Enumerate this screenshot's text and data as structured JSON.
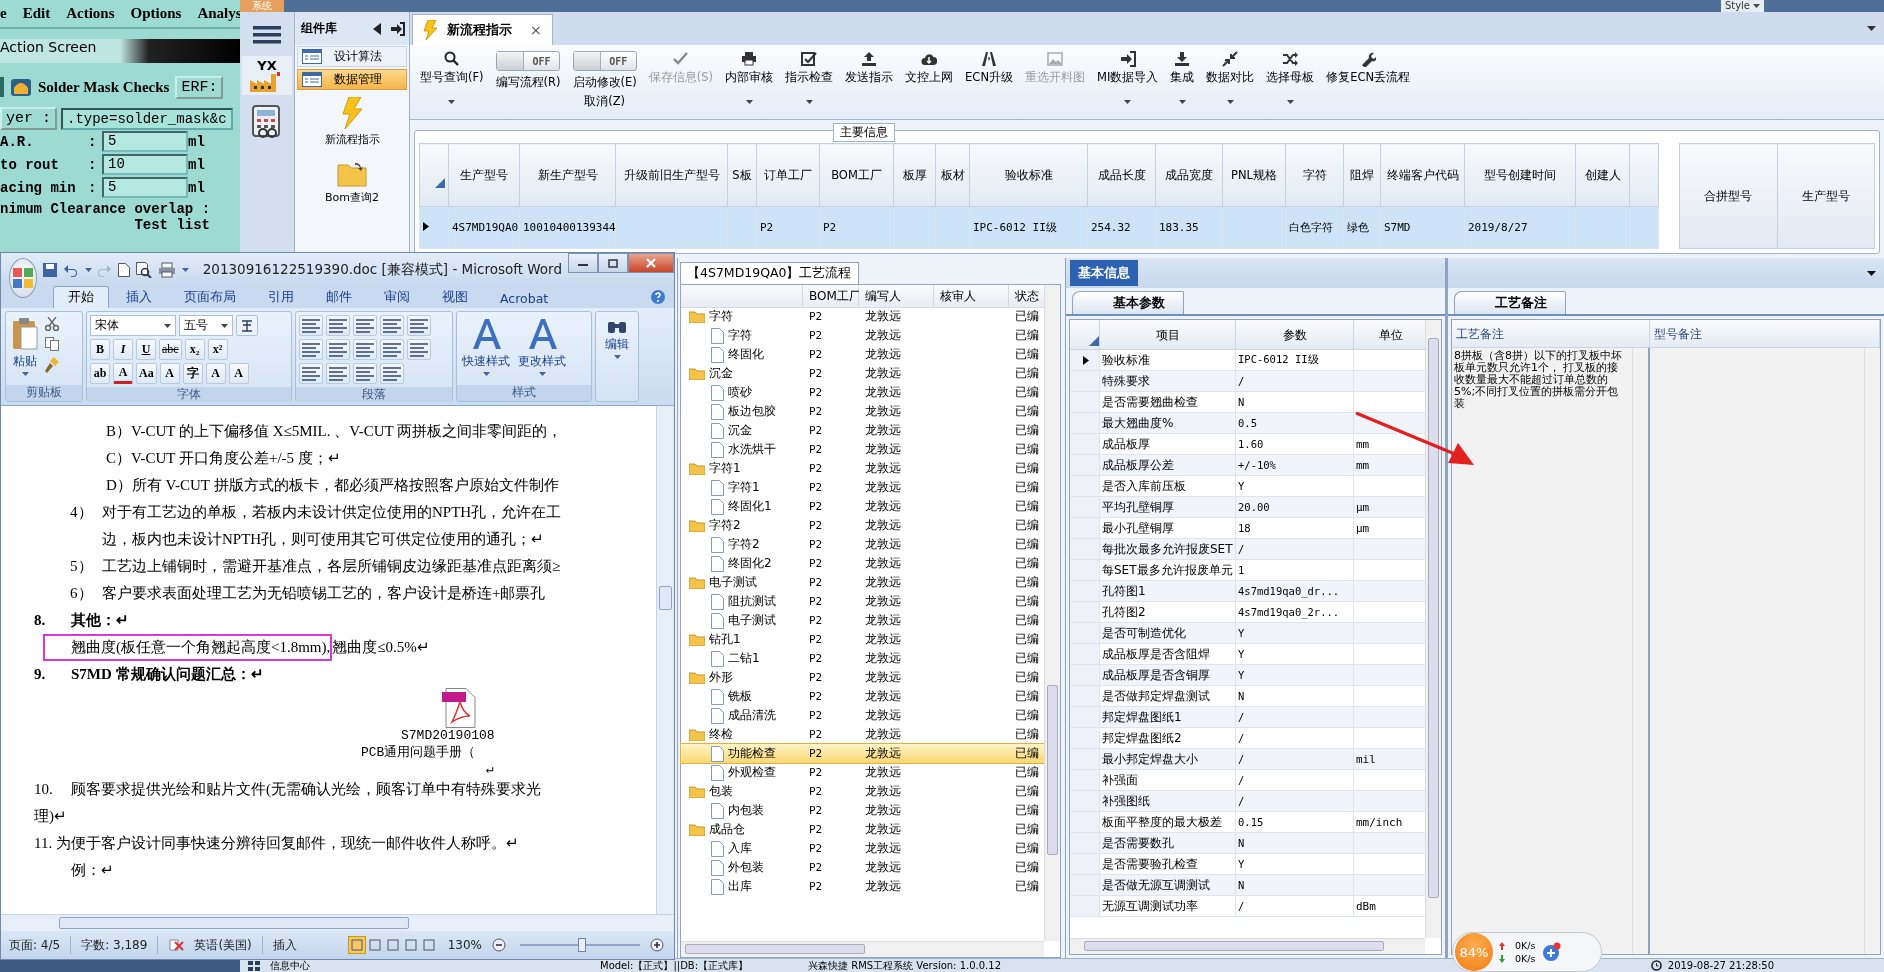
{
  "legacy_app": {
    "menu": [
      "e",
      "Edit",
      "Actions",
      "Options",
      "Analys"
    ],
    "title": "Action Screen",
    "panel_title": "Solder Mask Checks",
    "erf_label": "ERF:",
    "layer_label": "yer :",
    "layer_value": ".type=solder_mask&c",
    "fields": [
      {
        "label": "A.R.",
        "colon": ":",
        "value": "5",
        "unit": "ml"
      },
      {
        "label": "to rout",
        "colon": ":",
        "value": "10",
        "unit": "ml"
      },
      {
        "label": "acing min",
        "colon": ":",
        "value": "5",
        "unit": "ml"
      }
    ],
    "overlap_label": "nimum Clearance overlap :",
    "test_list_label": "Test list"
  },
  "app": {
    "system_tab": "系统",
    "style_menu": "Style",
    "logo_text": "YX",
    "library": {
      "title": "组件库",
      "groups": [
        {
          "label": "设计算法",
          "selected": false
        },
        {
          "label": "数据管理",
          "selected": true
        }
      ],
      "items": [
        {
          "label": "新流程指示",
          "kind": "bolt"
        },
        {
          "label": "Bom查询2",
          "kind": "folder"
        }
      ]
    },
    "tabs": [
      {
        "label": "新流程指示",
        "selected": true,
        "close": "×"
      }
    ],
    "toolbar": [
      {
        "kind": "button",
        "label": "型号查询(F)",
        "dropdown": true,
        "disabled": false
      },
      {
        "kind": "toggle",
        "label": "编写流程(R)",
        "switch_text": "OFF",
        "on": false
      },
      {
        "kind": "toggle",
        "label": "启动修改(E)",
        "sublabel": "取消(Z)",
        "switch_text": "OFF",
        "on": false
      },
      {
        "kind": "button",
        "label": "保存信息(S)",
        "dropdown": false,
        "disabled": true
      },
      {
        "kind": "button",
        "label": "内部审核",
        "dropdown": true,
        "disabled": false
      },
      {
        "kind": "button",
        "label": "指示检查",
        "dropdown": true,
        "disabled": false
      },
      {
        "kind": "button",
        "label": "发送指示",
        "dropdown": false,
        "disabled": false
      },
      {
        "kind": "button",
        "label": "文控上网",
        "dropdown": false,
        "disabled": false
      },
      {
        "kind": "button",
        "label": "ECN升级",
        "dropdown": false,
        "disabled": false
      },
      {
        "kind": "button",
        "label": "重选开料图",
        "dropdown": false,
        "disabled": true
      },
      {
        "kind": "button",
        "label": "MI数据导入",
        "dropdown": true,
        "disabled": false
      },
      {
        "kind": "button",
        "label": "集成",
        "dropdown": true,
        "disabled": false
      },
      {
        "kind": "button",
        "label": "数据对比",
        "dropdown": true,
        "disabled": false
      },
      {
        "kind": "button",
        "label": "选择母板",
        "dropdown": true,
        "disabled": false
      },
      {
        "kind": "button",
        "label": "修复ECN丢流程",
        "dropdown": false,
        "disabled": false
      }
    ],
    "main_info": {
      "title": "主要信息",
      "columns": [
        "生产型号",
        "新生产型号",
        "升级前旧生产型号",
        "S板",
        "订单工厂",
        "BOM工厂",
        "板厚",
        "板材",
        "验收标准",
        "成品长度",
        "成品宽度",
        "PNL规格",
        "字符",
        "阻焊",
        "终端客户代码",
        "型号创建时间",
        "创建人"
      ],
      "rows": [
        {
          "selected": true,
          "cells": {
            "col_1": "4S7MD19QA0",
            "col_2": "10010400139344",
            "col_5": "P2",
            "col_6": "P2",
            "col_9": "IPC-6012 II级",
            "col_10": "254.32",
            "col_11": "183.35",
            "col_13": "白色字符",
            "col_14": "绿色",
            "col_15": "S7MD",
            "col_16": "2019/8/27"
          }
        }
      ],
      "side_columns": [
        "合拼型号",
        "生产型号"
      ]
    }
  },
  "process_flow": {
    "title": "【4S7MD19QA0】工艺流程",
    "columns": [
      "BOM工厂",
      "编写人",
      "核审人",
      "状态"
    ],
    "tree": [
      {
        "label": "字符",
        "bom_factory": "P2",
        "author": "龙敦远",
        "status": "已编",
        "selected": false,
        "children": [
          {
            "label": "字符",
            "bom_factory": "P2",
            "author": "龙敦远",
            "status": "已编",
            "selected": false
          },
          {
            "label": "终固化",
            "bom_factory": "P2",
            "author": "龙敦远",
            "status": "已编",
            "selected": false
          }
        ]
      },
      {
        "label": "沉金",
        "bom_factory": "P2",
        "author": "龙敦远",
        "status": "已编",
        "selected": false,
        "children": [
          {
            "label": "喷砂",
            "bom_factory": "P2",
            "author": "龙敦远",
            "status": "已编",
            "selected": false
          },
          {
            "label": "板边包胶",
            "bom_factory": "P2",
            "author": "龙敦远",
            "status": "已编",
            "selected": false
          },
          {
            "label": "沉金",
            "bom_factory": "P2",
            "author": "龙敦远",
            "status": "已编",
            "selected": false
          },
          {
            "label": "水洗烘干",
            "bom_factory": "P2",
            "author": "龙敦远",
            "status": "已编",
            "selected": false
          }
        ]
      },
      {
        "label": "字符1",
        "bom_factory": "P2",
        "author": "龙敦远",
        "status": "已编",
        "selected": false,
        "children": [
          {
            "label": "字符1",
            "bom_factory": "P2",
            "author": "龙敦远",
            "status": "已编",
            "selected": false
          },
          {
            "label": "终固化1",
            "bom_factory": "P2",
            "author": "龙敦远",
            "status": "已编",
            "selected": false
          }
        ]
      },
      {
        "label": "字符2",
        "bom_factory": "P2",
        "author": "龙敦远",
        "status": "已编",
        "selected": false,
        "children": [
          {
            "label": "字符2",
            "bom_factory": "P2",
            "author": "龙敦远",
            "status": "已编",
            "selected": false
          },
          {
            "label": "终固化2",
            "bom_factory": "P2",
            "author": "龙敦远",
            "status": "已编",
            "selected": false
          }
        ]
      },
      {
        "label": "电子测试",
        "bom_factory": "P2",
        "author": "龙敦远",
        "status": "已编",
        "selected": false,
        "children": [
          {
            "label": "阻抗测试",
            "bom_factory": "P2",
            "author": "龙敦远",
            "status": "已编",
            "selected": false
          },
          {
            "label": "电子测试",
            "bom_factory": "P2",
            "author": "龙敦远",
            "status": "已编",
            "selected": false
          }
        ]
      },
      {
        "label": "钻孔1",
        "bom_factory": "P2",
        "author": "龙敦远",
        "status": "已编",
        "selected": false,
        "children": [
          {
            "label": "二钻1",
            "bom_factory": "P2",
            "author": "龙敦远",
            "status": "已编",
            "selected": false
          }
        ]
      },
      {
        "label": "外形",
        "bom_factory": "P2",
        "author": "龙敦远",
        "status": "已编",
        "selected": false,
        "children": [
          {
            "label": "铣板",
            "bom_factory": "P2",
            "author": "龙敦远",
            "status": "已编",
            "selected": false
          },
          {
            "label": "成品清洗",
            "bom_factory": "P2",
            "author": "龙敦远",
            "status": "已编",
            "selected": false
          }
        ]
      },
      {
        "label": "终检",
        "bom_factory": "P2",
        "author": "龙敦远",
        "status": "已编",
        "selected": false,
        "children": [
          {
            "label": "功能检查",
            "bom_factory": "P2",
            "author": "龙敦远",
            "status": "已编",
            "selected": true
          },
          {
            "label": "外观检查",
            "bom_factory": "P2",
            "author": "龙敦远",
            "status": "已编",
            "selected": false
          }
        ]
      },
      {
        "label": "包装",
        "bom_factory": "P2",
        "author": "龙敦远",
        "status": "已编",
        "selected": false,
        "children": [
          {
            "label": "内包装",
            "bom_factory": "P2",
            "author": "龙敦远",
            "status": "已编",
            "selected": false
          }
        ]
      },
      {
        "label": "成品仓",
        "bom_factory": "P2",
        "author": "龙敦远",
        "status": "已编",
        "selected": false,
        "children": [
          {
            "label": "入库",
            "bom_factory": "P2",
            "author": "龙敦远",
            "status": "已编",
            "selected": false
          },
          {
            "label": "外包装",
            "bom_factory": "P2",
            "author": "龙敦远",
            "status": "已编",
            "selected": false
          },
          {
            "label": "出库",
            "bom_factory": "P2",
            "author": "龙敦远",
            "status": "已编",
            "selected": false
          }
        ]
      }
    ]
  },
  "basic_info": {
    "panel_tab": "基本信息",
    "tab": "基本参数",
    "columns": [
      "项目",
      "参数",
      "单位"
    ],
    "rows": [
      {
        "item": "验收标准",
        "value": "IPC-6012 II级",
        "current": true
      },
      {
        "item": "特殊要求",
        "value": "/",
        "current": false
      },
      {
        "item": "是否需要翘曲检查",
        "value": "N",
        "current": false
      },
      {
        "item": "最大翘曲度%",
        "value": "0.5",
        "current": false
      },
      {
        "item": "成品板厚",
        "value": "1.60",
        "unit": "mm",
        "current": false
      },
      {
        "item": "成品板厚公差",
        "value": "+/-10%",
        "unit": "mm",
        "current": false
      },
      {
        "item": "是否入库前压板",
        "value": "Y",
        "current": false
      },
      {
        "item": "平均孔壁铜厚",
        "value": "20.00",
        "unit": "μm",
        "current": false
      },
      {
        "item": "最小孔壁铜厚",
        "value": "18",
        "unit": "μm",
        "current": false
      },
      {
        "item": "每批次最多允许报废SET",
        "value": "/",
        "current": false
      },
      {
        "item": "每SET最多允许报废单元",
        "value": "1",
        "current": false
      },
      {
        "item": "孔符图1",
        "value": "4s7md19qa0_dr...",
        "current": false
      },
      {
        "item": "孔符图2",
        "value": "4s7md19qa0_2r...",
        "current": false
      },
      {
        "item": "是否可制造优化",
        "value": "Y",
        "current": false
      },
      {
        "item": "成品板厚是否含阻焊",
        "value": "Y",
        "current": false
      },
      {
        "item": "成品板厚是否含铜厚",
        "value": "Y",
        "current": false
      },
      {
        "item": "是否做邦定焊盘测试",
        "value": "N",
        "current": false
      },
      {
        "item": "邦定焊盘图纸1",
        "value": "/",
        "current": false
      },
      {
        "item": "邦定焊盘图纸2",
        "value": "/",
        "current": false
      },
      {
        "item": "最小邦定焊盘大小",
        "value": "/",
        "unit": "mil",
        "current": false
      },
      {
        "item": "补强面",
        "value": "/",
        "current": false
      },
      {
        "item": "补强图纸",
        "value": "/",
        "current": false
      },
      {
        "item": "板面平整度的最大极差",
        "value": "0.15",
        "unit": "mm/inch",
        "current": false
      },
      {
        "item": "是否需要数孔",
        "value": "N",
        "current": false
      },
      {
        "item": "是否需要验孔检查",
        "value": "Y",
        "current": false
      },
      {
        "item": "是否做无源互调测试",
        "value": "N",
        "current": false
      },
      {
        "item": "无源互调测试功率",
        "value": "/",
        "unit": "dBm",
        "current": false
      }
    ]
  },
  "remarks": {
    "tab": "工艺备注",
    "columns": [
      "工艺备注",
      "型号备注"
    ],
    "process_note": "8拼板（含8拼）以下的打叉板中坏板单元数只允许1个， 打叉板的接收数量最大不能超过订单总数的5%;不同打叉位置的拼板需分开包装"
  },
  "status_bar": {
    "info_center": "信息中心",
    "model": "Model:【正式】||DB:【正式库】",
    "version": "兴森快捷 RMS工程系统 Version: 1.0.0.12",
    "time": "2019-08-27 21:28:50"
  },
  "net_widget": {
    "percent": "84%",
    "up": "0K/s",
    "down": "0K/s"
  },
  "word": {
    "title": "20130916122519390.doc [兼容模式] - Microsoft Word",
    "tabs": [
      {
        "label": "开始",
        "selected": true
      },
      {
        "label": "插入",
        "selected": false
      },
      {
        "label": "页面布局",
        "selected": false
      },
      {
        "label": "引用",
        "selected": false
      },
      {
        "label": "邮件",
        "selected": false
      },
      {
        "label": "审阅",
        "selected": false
      },
      {
        "label": "视图",
        "selected": false
      },
      {
        "label": "Acrobat",
        "selected": false
      }
    ],
    "paste": "粘贴",
    "font_name": "宋体",
    "font_size": "五号",
    "font_buttons": [
      "B",
      "I",
      "U",
      "abc",
      "x₂",
      "x²"
    ],
    "font_buttons_2": [
      "ab",
      "A",
      "Aa",
      "A",
      "字",
      "A",
      "A"
    ],
    "quick_style": "快速样式",
    "change_style": "更改样式",
    "edit": "编辑",
    "groups": [
      "剪贴板",
      "字体",
      "段落",
      "样式"
    ],
    "lines": [
      {
        "kind": "sub",
        "text": "B）V-CUT 的上下偏移值 X≤5MIL. 、V-CUT 两拼板之间非零间距的，"
      },
      {
        "kind": "sub",
        "text": "C）V-CUT 开口角度公差+/-5 度；↵"
      },
      {
        "kind": "sub",
        "text": "D）所有 V-CUT 拼版方式的板卡，都必须严格按照客户原始文件制作"
      },
      {
        "kind": "item",
        "number": "4）",
        "text": "对于有工艺边的单板，若板内未设计供定位使用的NPTH孔，允许在工"
      },
      {
        "kind": "cont",
        "text": "边，板内也未设计NPTH孔，则可使用其它可供定位使用的通孔；↵"
      },
      {
        "kind": "item",
        "number": "5）",
        "text": "工艺边上铺铜时，需避开基准点，各层所铺铜皮边缘距基准点距离须≥"
      },
      {
        "kind": "item",
        "number": "6）",
        "text": "客户要求表面处理工艺为无铅喷锡工艺的，客户设计是桥连+邮票孔"
      },
      {
        "kind": "heading",
        "number": "8.",
        "text": "其他：↵"
      },
      {
        "kind": "boxed",
        "boxed": "翘曲度(板任意一个角翘起高度<1.8mm),",
        "text": "翘曲度≤0.5%↵"
      },
      {
        "kind": "heading",
        "number": "9.",
        "text": "S7MD 常规确认问题汇总：↵"
      },
      {
        "kind": "attachment",
        "text": "S7MD20190108",
        "text_2": "PCB通用问题手册（",
        "after": "↵"
      },
      {
        "kind": "numbered",
        "number": "10.",
        "text": "顾客要求提供光绘和贴片文件(无需确认光绘，顾客订单中有特殊要求光"
      },
      {
        "kind": "plain",
        "text": "理)↵"
      },
      {
        "kind": "plain",
        "text": "11. 为便于客户设计同事快速分辨待回复邮件，现统一邮件收件人称呼。↵"
      },
      {
        "kind": "example",
        "text": "例：↵"
      }
    ],
    "status": {
      "page": "页面: 4/5",
      "words": "字数: 3,189",
      "language": "英语(美国)",
      "mode": "插入",
      "zoom": "130%"
    },
    "zoom_slider": {
      "level": 0.52
    }
  }
}
